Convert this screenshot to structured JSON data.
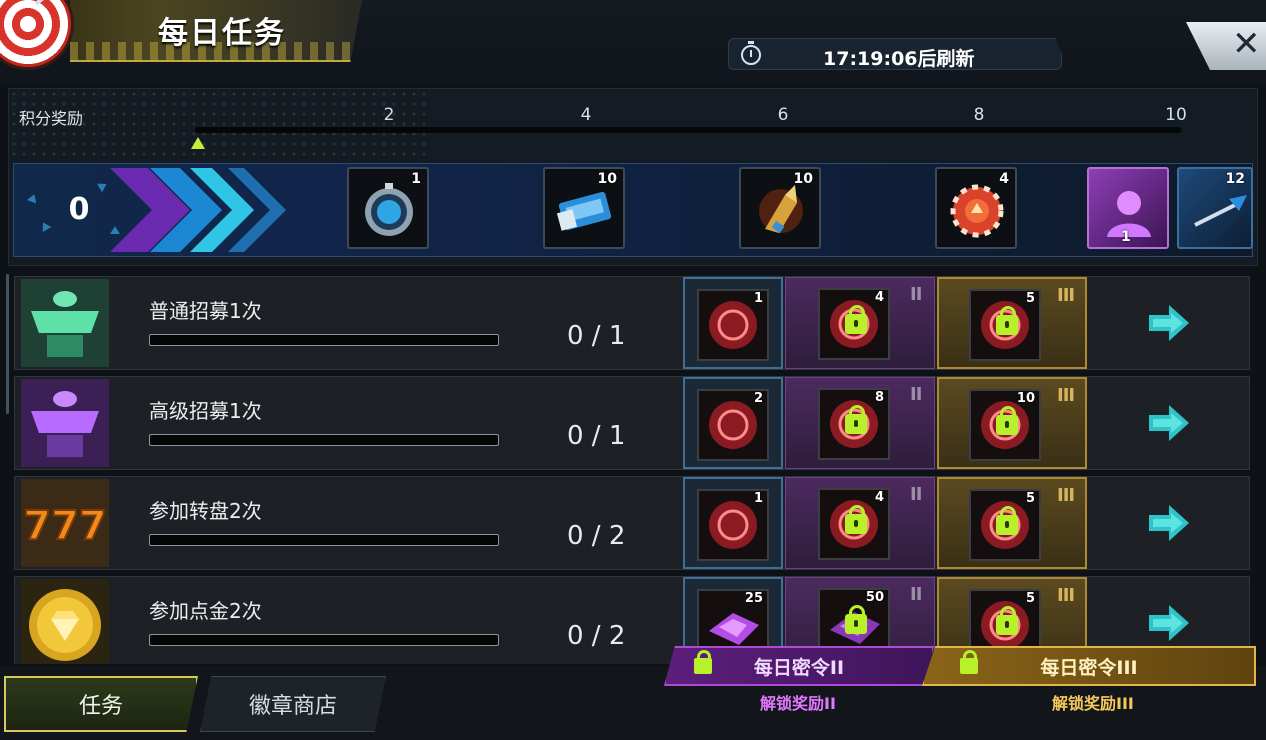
{
  "header": {
    "title": "每日任务",
    "timer_text": "17:19:06后刷新",
    "close_symbol": "✕"
  },
  "points": {
    "label": "积分奖励",
    "current": 0,
    "max": 10,
    "milestones": [
      "2",
      "4",
      "6",
      "8",
      "10"
    ],
    "rewards": [
      {
        "count": "1",
        "icon": "stopwatch-icon"
      },
      {
        "count": "10",
        "icon": "cinema-ticket-icon"
      },
      {
        "count": "10",
        "icon": "bullet-icon"
      },
      {
        "count": "4",
        "icon": "casino-chip-icon"
      },
      {
        "count": "1",
        "icon": "avatar-frame-icon"
      },
      {
        "count": "12",
        "icon": "dart-icon"
      }
    ]
  },
  "tasks": [
    {
      "name": "普通招募1次",
      "progress": "0 / 1",
      "fraction": 0,
      "icon": "normal-recruit-icon",
      "tier_rewards": [
        {
          "count": "1",
          "icon": "red-token-icon"
        },
        {
          "count": "4",
          "icon": "red-token-icon"
        },
        {
          "count": "5",
          "icon": "red-token-icon"
        }
      ]
    },
    {
      "name": "高级招募1次",
      "progress": "0 / 1",
      "fraction": 0,
      "icon": "advanced-recruit-icon",
      "tier_rewards": [
        {
          "count": "2",
          "icon": "red-token-icon"
        },
        {
          "count": "8",
          "icon": "red-token-icon"
        },
        {
          "count": "10",
          "icon": "red-token-icon"
        }
      ]
    },
    {
      "name": "参加转盘2次",
      "progress": "0 / 2",
      "fraction": 0,
      "icon": "slot-777-icon",
      "tier_rewards": [
        {
          "count": "1",
          "icon": "red-token-icon"
        },
        {
          "count": "4",
          "icon": "red-token-icon"
        },
        {
          "count": "5",
          "icon": "red-token-icon"
        }
      ]
    },
    {
      "name": "参加点金2次",
      "progress": "0 / 2",
      "fraction": 0,
      "icon": "gold-diamond-icon",
      "tier_rewards": [
        {
          "count": "25",
          "icon": "purple-gem-icon"
        },
        {
          "count": "50",
          "icon": "purple-gem-icon"
        },
        {
          "count": "5",
          "icon": "red-token-icon"
        }
      ]
    }
  ],
  "tiers": {
    "ii": "II",
    "iii": "III"
  },
  "tabs": {
    "tasks": "任务",
    "shop": "徽章商店"
  },
  "pass": {
    "ii_label": "每日密令II",
    "ii_unlock": "解锁奖励II",
    "iii_label": "每日密令III",
    "iii_unlock": "解锁奖励III"
  },
  "colors": {
    "accent_green": "#b8f02a",
    "tier_ii": "#b048d8",
    "tier_iii": "#e1b548",
    "tier_i": "#3f6f96"
  }
}
